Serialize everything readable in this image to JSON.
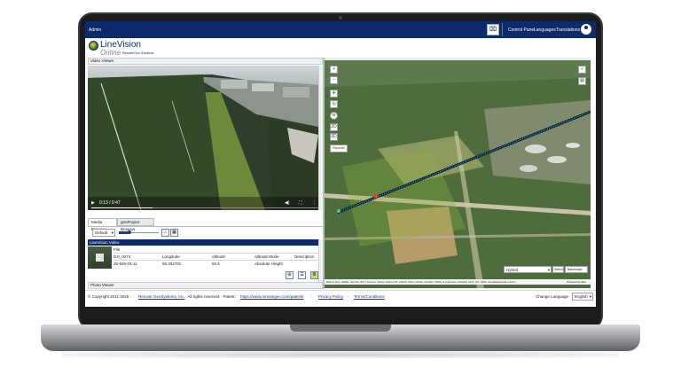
{
  "topbar": {
    "admin_label": "Admin",
    "nav": [
      "Control Panel",
      "Languages",
      "Translations"
    ]
  },
  "logo": {
    "line1": "LineVision",
    "line2": "Online",
    "tagline": "Remote/Geo-Solutions"
  },
  "video_viewer": {
    "title": "Video Viewer",
    "time": "0:13 / 0:47"
  },
  "media": {
    "tabs": [
      "Media Browser",
      "geoProject Browser"
    ],
    "view_select": "Default",
    "section_title": "LineVision Video",
    "file_header": "File",
    "file_name": "DJI_0274",
    "columns": [
      "Longitude",
      "Altitude",
      "Altitude Mode",
      "Description"
    ],
    "row": {
      "date": "26-925-03-11",
      "longitude": "95.302781",
      "altitude": "85.6",
      "altitude_mode": "Absolute Height",
      "description": ""
    }
  },
  "photo_viewer": {
    "title": "Photo Viewer"
  },
  "map": {
    "buttons_2d": "2D",
    "buttons_3d": "3D",
    "reporter": "Reporter",
    "layer_select": "Hybrid",
    "select_button": "Select",
    "basemaps_button": "Basemaps",
    "attribution": "Esprit | Esri, HERE, Garmin, IPC | Source: Vector, Airbus DS, USGS, NGA, NASA, CGIAR, USDA, 0 Andeman, NCEAS, NLS, OS, NMA, Geodatastyrelsen and t...",
    "powered_by": "Powered by Esri"
  },
  "footer": {
    "copyright": "© Copyright 2011-2026 ·",
    "company": "Remote GeoSystems, Inc.",
    "rights": "· All rights reserved · Patent:",
    "patents": "https://www.remotegeo.com/patents",
    "privacy": "Privacy Policy",
    "terms": "Terms/Conditions",
    "change_language": "Change Language",
    "language": "English"
  },
  "colors": {
    "brand": "#0d2a6c",
    "accent": "#1b3d8f"
  },
  "icons": [
    "scan-icon",
    "user-icon",
    "home-icon",
    "layers-icon",
    "zoom-in-icon",
    "zoom-out-icon",
    "compass-icon",
    "search-icon",
    "play-icon",
    "grid-view-icon",
    "list-view-icon",
    "detail-view-icon"
  ]
}
